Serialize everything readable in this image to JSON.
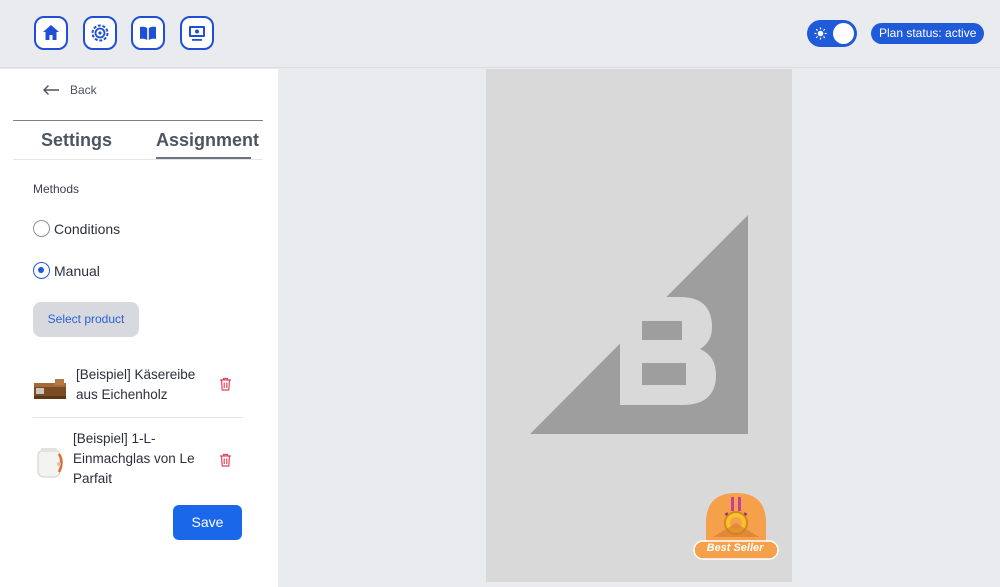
{
  "topbar": {
    "nav_icons": [
      "home-icon",
      "gear-icon",
      "book-icon",
      "monitor-icon"
    ],
    "theme_toggle": {
      "state": "on",
      "icon": "sun-icon"
    },
    "plan_status": "Plan status: active"
  },
  "sidebar": {
    "back_label": "Back",
    "tabs": [
      {
        "label": "Settings",
        "active": false
      },
      {
        "label": "Assignment",
        "active": true
      }
    ],
    "methods_label": "Methods",
    "methods": [
      {
        "label": "Conditions",
        "checked": false
      },
      {
        "label": "Manual",
        "checked": true
      }
    ],
    "select_product_label": "Select product",
    "products": [
      {
        "name": "[Beispiel] Käsereibe aus Eichenholz",
        "thumb": "grater-thumb"
      },
      {
        "name": "[Beispiel] 1-L-Einmachglas von Le Parfait",
        "thumb": "jar-thumb"
      }
    ],
    "save_label": "Save"
  },
  "preview": {
    "logo": "bigcommerce-logo",
    "badge_text": "Best Seller"
  },
  "colors": {
    "accent": "#1f5ad8",
    "save_button": "#1b67ea",
    "trash": "#e0455d",
    "badge_orange": "#f5a04a"
  }
}
